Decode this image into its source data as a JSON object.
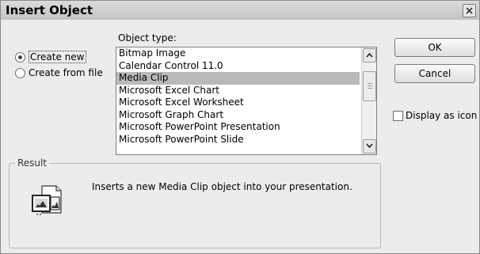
{
  "window": {
    "title": "Insert Object"
  },
  "options": {
    "create_new": "Create new",
    "create_from_file": "Create from file"
  },
  "object_type": {
    "label": "Object type:",
    "items": [
      "Bitmap Image",
      "Calendar Control 11.0",
      "Media Clip",
      "Microsoft Excel Chart",
      "Microsoft Excel Worksheet",
      "Microsoft Graph Chart",
      "Microsoft PowerPoint Presentation",
      "Microsoft PowerPoint Slide"
    ],
    "selected": "Media Clip"
  },
  "buttons": {
    "ok": "OK",
    "cancel": "Cancel"
  },
  "display_as_icon": "Display as icon",
  "result": {
    "legend": "Result",
    "text": "Inserts a new Media Clip object into your presentation."
  },
  "icons": {
    "close": "close-icon",
    "scroll_up": "scroll-up-icon",
    "scroll_down": "scroll-down-icon",
    "result": "media-clip-object-icon"
  },
  "colors": {
    "selection": "#b9b9b9",
    "dialog_bg": "#ececec"
  }
}
